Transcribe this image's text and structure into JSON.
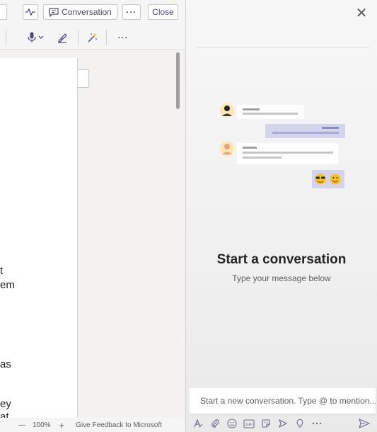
{
  "toolbar": {
    "conversation_label": "Conversation",
    "close_label": "Close",
    "more_label": "···",
    "more2_label": "···"
  },
  "document": {
    "fragments": [
      "t",
      "em",
      "as",
      "ey",
      "at"
    ]
  },
  "statusbar": {
    "zoom_minus": "—",
    "zoom_level": "100%",
    "zoom_plus": "+",
    "feedback": "Give Feedback to Microsoft"
  },
  "panel": {
    "close_glyph": "✕",
    "title": "Start a conversation",
    "subtitle": "Type your message below",
    "compose_placeholder": "Start a new conversation. Type @ to mention..."
  },
  "colors": {
    "accent": "#6264a7",
    "bubble_purple": "#d4d4ec",
    "bubble_white": "#ffffff"
  }
}
